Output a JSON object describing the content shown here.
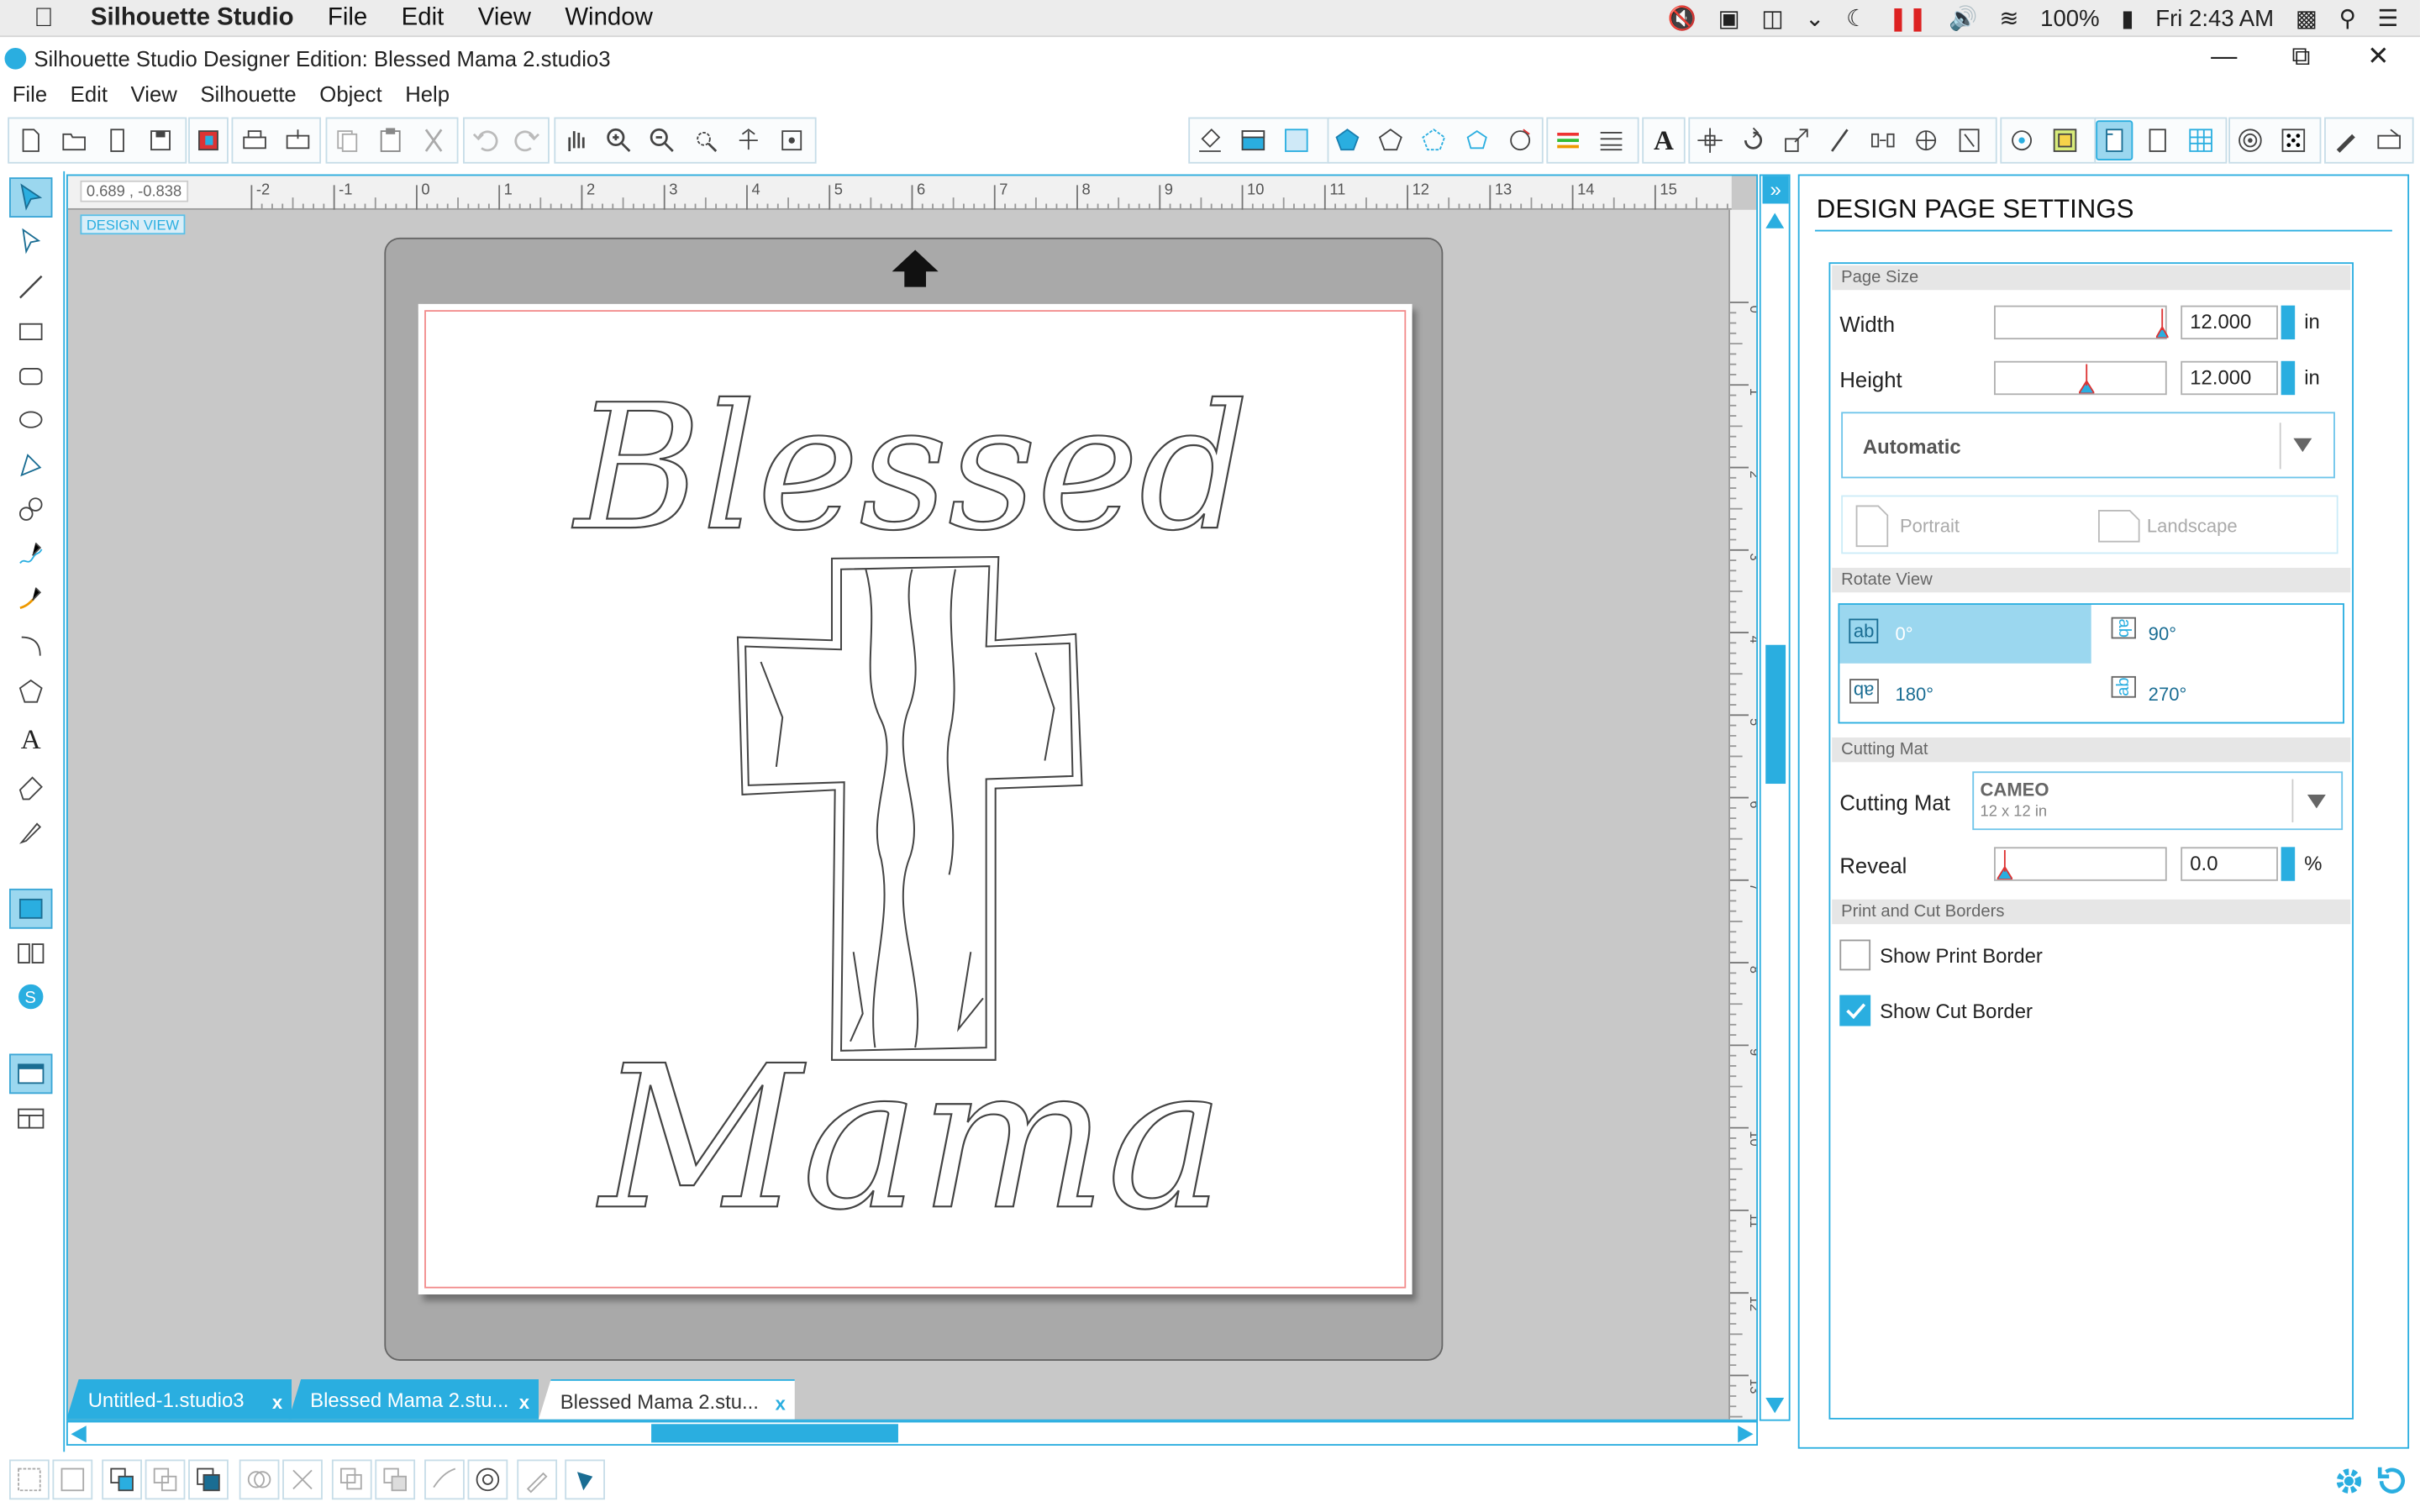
{
  "menubar": {
    "app_name": "Silhouette Studio",
    "items": [
      "File",
      "Edit",
      "View",
      "Window"
    ],
    "battery": "100%",
    "clock": "Fri 2:43 AM"
  },
  "window": {
    "title": "Silhouette Studio Designer Edition: Blessed Mama 2.studio3"
  },
  "app_menu": [
    "File",
    "Edit",
    "View",
    "Silhouette",
    "Object",
    "Help"
  ],
  "canvas": {
    "coords": "0.689 , -0.838",
    "design_view_label": "DESIGN VIEW",
    "h_ruler_ticks": [
      "-2",
      "-1",
      "0",
      "1",
      "2",
      "3",
      "4",
      "5",
      "6",
      "7",
      "8",
      "9",
      "10",
      "11",
      "12",
      "13",
      "14",
      "15"
    ],
    "v_ruler_ticks": [
      "0",
      "1",
      "2",
      "3",
      "4",
      "5",
      "6",
      "7",
      "8",
      "9",
      "10",
      "11",
      "12",
      "13"
    ],
    "design_text_top": "Blessed",
    "design_text_bottom": "Mama"
  },
  "tabs": [
    {
      "label": "Untitled-1.studio3",
      "close": "x"
    },
    {
      "label": "Blessed Mama 2.stu...",
      "close": "x"
    },
    {
      "label": "Blessed Mama 2.stu...",
      "close": "x"
    }
  ],
  "panel": {
    "title": "DESIGN PAGE SETTINGS",
    "page_size": {
      "header": "Page Size",
      "width_label": "Width",
      "width_value": "12.000",
      "height_label": "Height",
      "height_value": "12.000",
      "unit": "in",
      "preset": "Automatic",
      "portrait": "Portrait",
      "landscape": "Landscape"
    },
    "rotate_view": {
      "header": "Rotate View",
      "options": [
        "0°",
        "90°",
        "180°",
        "270°"
      ],
      "selected": "0°"
    },
    "cutting_mat": {
      "header": "Cutting Mat",
      "label": "Cutting Mat",
      "value": "CAMEO",
      "sub": "12 x 12 in",
      "reveal_label": "Reveal",
      "reveal_value": "0.0",
      "reveal_unit": "%"
    },
    "borders": {
      "header": "Print and Cut Borders",
      "print_label": "Show Print Border",
      "print_checked": false,
      "cut_label": "Show Cut Border",
      "cut_checked": true
    }
  },
  "colors": {
    "accent": "#2aaee0",
    "selected_bg": "#9bd7ef",
    "mat": "#a9a9a9",
    "cut_border": "#f28b8b"
  }
}
